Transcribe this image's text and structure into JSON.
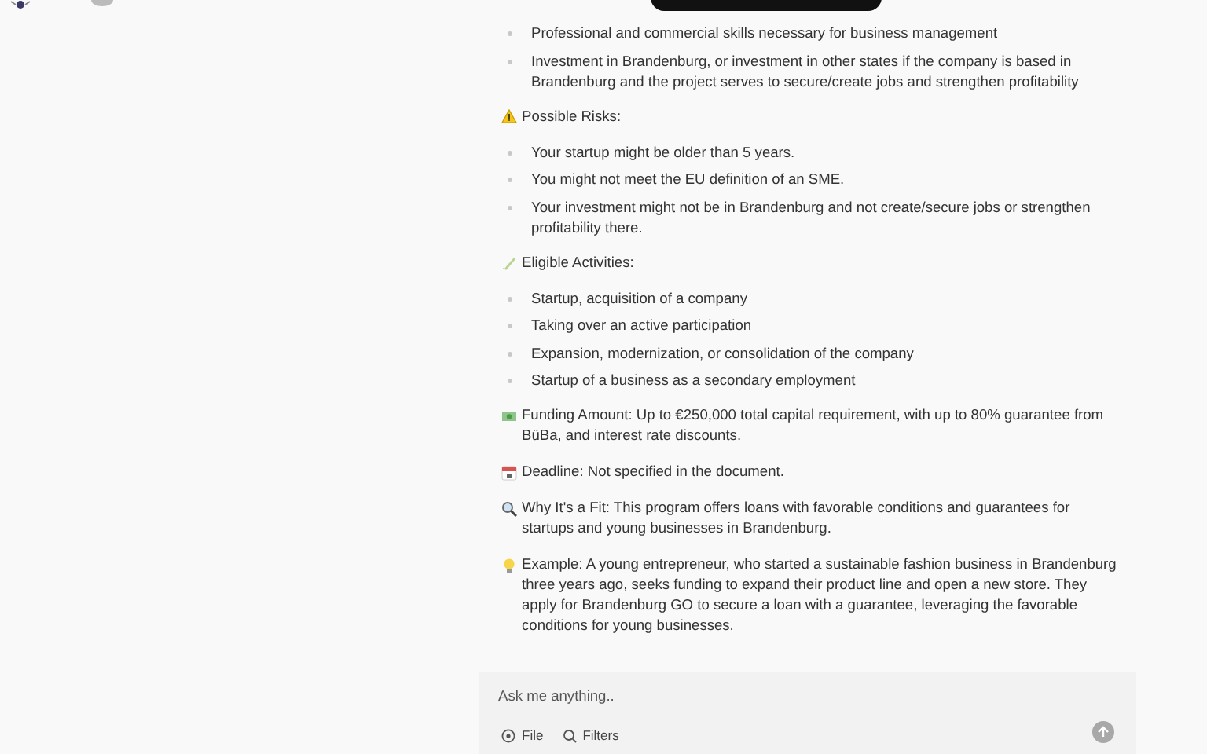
{
  "blocks": [
    {
      "kind": "list",
      "items": [
        "Professional and commercial skills necessary for business management",
        "Investment in Brandenburg, or investment in other states if the company is based in Brandenburg and the project serves to secure/create jobs and strengthen profitability"
      ]
    },
    {
      "kind": "warning",
      "text": "Possible Risks:"
    },
    {
      "kind": "list",
      "items": [
        "Your startup might be older than 5 years.",
        "You might not meet the EU definition of an SME.",
        "Your investment might not be in Brandenburg and not create/secure jobs or strengthen profitability there."
      ]
    },
    {
      "kind": "pencil",
      "text": "Eligible Activities:"
    },
    {
      "kind": "list",
      "items": [
        "Startup, acquisition of a company",
        "Taking over an active participation",
        "Expansion, modernization, or consolidation of the company",
        "Startup of a business as a secondary employment"
      ]
    },
    {
      "kind": "money",
      "text": "Funding Amount: Up to €250,000 total capital requirement, with up to 80% guarantee from BüBa, and interest rate discounts."
    },
    {
      "kind": "calendar",
      "text": "Deadline: Not specified in the document."
    },
    {
      "kind": "search",
      "text": "Why It's a Fit: This program offers loans with favorable conditions and guarantees for startups and young businesses in Brandenburg."
    },
    {
      "kind": "bulb",
      "text": "Example: A young entrepreneur, who started a sustainable fashion business in Brandenburg three years ago, seeks funding to expand their product line and open a new store. They apply for Brandenburg GO to secure a loan with a guarantee, leveraging the favorable conditions for young businesses."
    }
  ],
  "composer": {
    "placeholder": "Ask me anything..",
    "buttons": [
      "File",
      "Filters"
    ]
  }
}
